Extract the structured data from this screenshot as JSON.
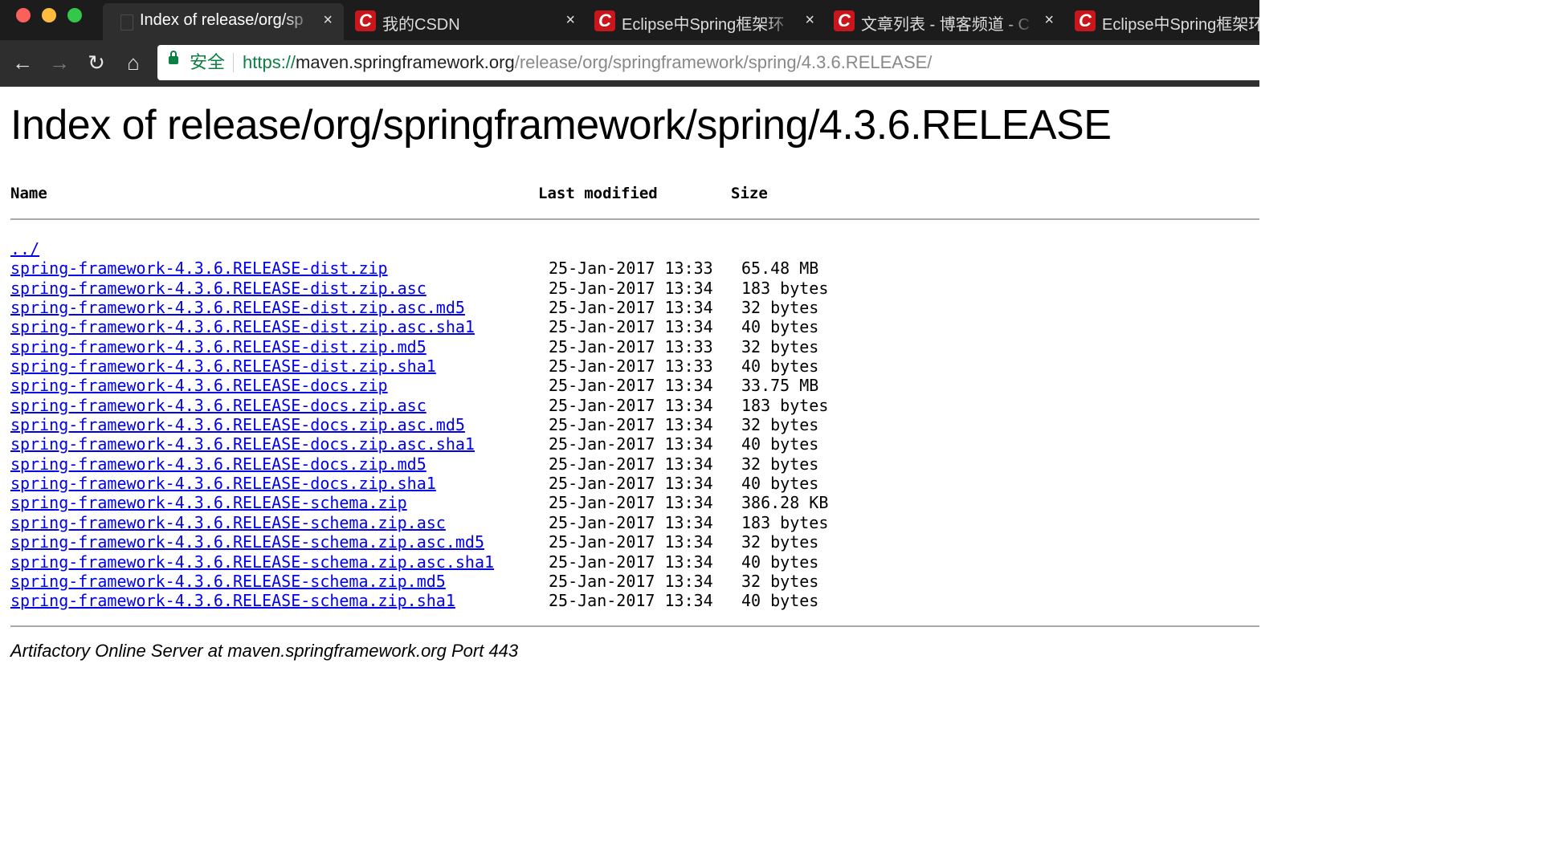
{
  "tabs": [
    {
      "title": "Index of release/org/sp",
      "active": true,
      "favicon": "page-icon"
    },
    {
      "title": "我的CSDN",
      "active": false,
      "favicon": "csdn-icon"
    },
    {
      "title": "Eclipse中Spring框架环",
      "active": false,
      "favicon": "csdn-icon"
    },
    {
      "title": "文章列表 - 博客频道 - C",
      "active": false,
      "favicon": "csdn-icon"
    },
    {
      "title": "Eclipse中Spring框架环",
      "active": false,
      "favicon": "csdn-icon"
    }
  ],
  "tab_close_glyph": "×",
  "favicon_letter": "C",
  "nav": {
    "back": "←",
    "forward": "→",
    "reload": "↻",
    "home": "⌂"
  },
  "omnibox": {
    "secure_label": "安全",
    "scheme": "https://",
    "host": "maven.springframework.org",
    "path": "/release/org/springframework/spring/4.3.6.RELEASE/"
  },
  "page": {
    "title": "Index of release/org/springframework/spring/4.3.6.RELEASE",
    "columns": {
      "name": "Name",
      "modified": "Last modified",
      "size": "Size"
    },
    "parent_link": "../",
    "files": [
      {
        "name": "spring-framework-4.3.6.RELEASE-dist.zip",
        "modified": "25-Jan-2017 13:33",
        "size": "65.48 MB"
      },
      {
        "name": "spring-framework-4.3.6.RELEASE-dist.zip.asc",
        "modified": "25-Jan-2017 13:34",
        "size": "183 bytes"
      },
      {
        "name": "spring-framework-4.3.6.RELEASE-dist.zip.asc.md5",
        "modified": "25-Jan-2017 13:34",
        "size": "32 bytes"
      },
      {
        "name": "spring-framework-4.3.6.RELEASE-dist.zip.asc.sha1",
        "modified": "25-Jan-2017 13:34",
        "size": "40 bytes"
      },
      {
        "name": "spring-framework-4.3.6.RELEASE-dist.zip.md5",
        "modified": "25-Jan-2017 13:33",
        "size": "32 bytes"
      },
      {
        "name": "spring-framework-4.3.6.RELEASE-dist.zip.sha1",
        "modified": "25-Jan-2017 13:33",
        "size": "40 bytes"
      },
      {
        "name": "spring-framework-4.3.6.RELEASE-docs.zip",
        "modified": "25-Jan-2017 13:34",
        "size": "33.75 MB"
      },
      {
        "name": "spring-framework-4.3.6.RELEASE-docs.zip.asc",
        "modified": "25-Jan-2017 13:34",
        "size": "183 bytes"
      },
      {
        "name": "spring-framework-4.3.6.RELEASE-docs.zip.asc.md5",
        "modified": "25-Jan-2017 13:34",
        "size": "32 bytes"
      },
      {
        "name": "spring-framework-4.3.6.RELEASE-docs.zip.asc.sha1",
        "modified": "25-Jan-2017 13:34",
        "size": "40 bytes"
      },
      {
        "name": "spring-framework-4.3.6.RELEASE-docs.zip.md5",
        "modified": "25-Jan-2017 13:34",
        "size": "32 bytes"
      },
      {
        "name": "spring-framework-4.3.6.RELEASE-docs.zip.sha1",
        "modified": "25-Jan-2017 13:34",
        "size": "40 bytes"
      },
      {
        "name": "spring-framework-4.3.6.RELEASE-schema.zip",
        "modified": "25-Jan-2017 13:34",
        "size": "386.28 KB"
      },
      {
        "name": "spring-framework-4.3.6.RELEASE-schema.zip.asc",
        "modified": "25-Jan-2017 13:34",
        "size": "183 bytes"
      },
      {
        "name": "spring-framework-4.3.6.RELEASE-schema.zip.asc.md5",
        "modified": "25-Jan-2017 13:34",
        "size": "32 bytes"
      },
      {
        "name": "spring-framework-4.3.6.RELEASE-schema.zip.asc.sha1",
        "modified": "25-Jan-2017 13:34",
        "size": "40 bytes"
      },
      {
        "name": "spring-framework-4.3.6.RELEASE-schema.zip.md5",
        "modified": "25-Jan-2017 13:34",
        "size": "32 bytes"
      },
      {
        "name": "spring-framework-4.3.6.RELEASE-schema.zip.sha1",
        "modified": "25-Jan-2017 13:34",
        "size": "40 bytes"
      }
    ],
    "footer": "Artifactory Online Server at maven.springframework.org Port 443"
  },
  "colors": {
    "link": "#0000ee",
    "secure_green": "#0b8043",
    "tabbar_bg": "#1c1c1c",
    "toolbar_bg": "#2e2e2e",
    "csdn_red": "#c9161c"
  }
}
